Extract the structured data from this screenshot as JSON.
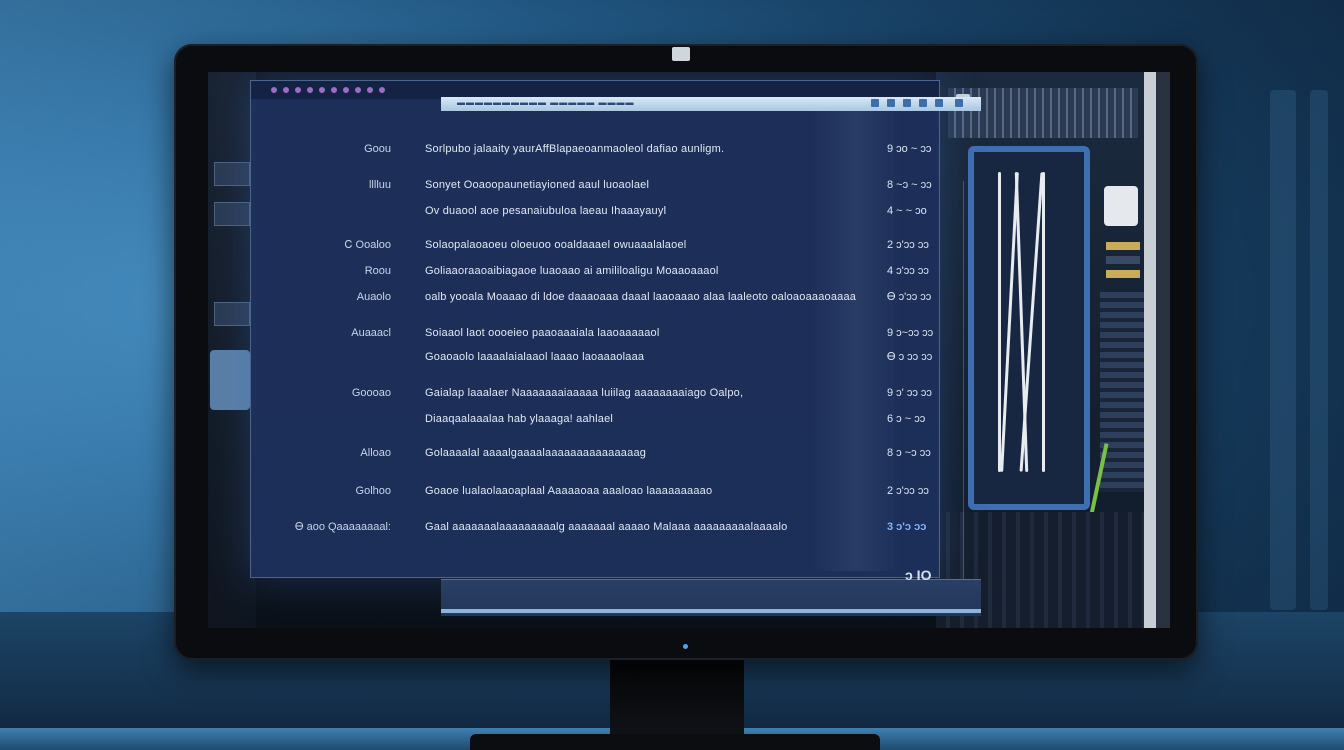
{
  "app_window": {
    "inner_title": "▬▬▬▬▬▬▬▬▬▬ ▬▬▬▬▬ ▬▬▬▬",
    "rows": [
      {
        "label": "Goou",
        "desc": "Sorlpubo jalaaity yaurAffBlapaeoanmaoleol dafiao aunligm.",
        "value": "9 ɔo ~ ɔɔ"
      },
      {
        "label": "lllluu",
        "desc": "Sonyet  Ooaoopaunetiayioned aaul luoaolael",
        "value": "8 ~ɔ ~ ɔɔ"
      },
      {
        "label": "",
        "desc": "Ov duaool aoe  pesanaiubuloa laeau Ihaaayauyl",
        "value": "4 ~ ~ ɔo"
      },
      {
        "label": "Ꮯ Ooaloo",
        "desc": "Solaopalaoaoeu oloeuoo ooaldaaael owuaaalalaoel",
        "value": "2 ɔ'ɔɔ ɔɔ"
      },
      {
        "label": "Roou",
        "desc": "Goliaaoraaoaibiagaoe luaoaao ai amililoaligu Moaaoaaaol",
        "value": "4 ɔ'ɔɔ ɔɔ"
      },
      {
        "label": "Auaolo",
        "desc": "oalb yooala Moaaao di ldoe daaaoaaa  daaal laaoaaao alaa laaleoto oaloaoaaaoaaaa",
        "value": "Ꮎ ɔ'ɔɔ ɔɔ"
      },
      {
        "label": "Auaaacl",
        "desc": "Soiaaol  laot oooeieo paaoaaaiala laaoaaaaaol",
        "value": "9 ɔ~ɔɔ ɔɔ"
      },
      {
        "label": "",
        "desc": "Goaoaolo laaaalaialaaol laaao laoaaaolaaa",
        "value": "Ꮎ ɔ ɔɔ ɔɔ"
      },
      {
        "label": "Goooao",
        "desc": "Gaialap laaalaer  Naaaaaaaiaaaaa luiilag  aaaaaaaaiago Oalpo,",
        "value": "9 ɔ' ɔɔ ɔɔ"
      },
      {
        "label": "",
        "desc": "Diaaqaalaaalaa hab ylaaaga!  aahlael",
        "value": "6 ɔ ~ ɔɔ"
      },
      {
        "label": "Alloao",
        "desc": "Golaaaalal  aaaalgaaaalaaaaaaaaaaaaaaag",
        "value": "8 ɔ  ~ɔ ɔɔ"
      },
      {
        "label": "Golhoo",
        "desc": "Goaoe lualaolaaoaplaal Aaaaaoaa aaaloao  laaaaaaaaao",
        "value": "2 ɔ'ɔɔ ɔɔ"
      },
      {
        "label": "Ꮎ aoo Qaaaaaaaal:",
        "desc": "Gaal aaaaaaalaaaaaaaaalg aaaaaaal aaaao Malaaa aaaaaaaaalaaaalo",
        "value": "3 ɔ'ɔ ɔɔ"
      }
    ],
    "footer_number": "ɔ IO"
  },
  "colors": {
    "accent": "#3e6fb0",
    "window_bg": "#1e325e",
    "highlight": "#7fb6ff"
  }
}
